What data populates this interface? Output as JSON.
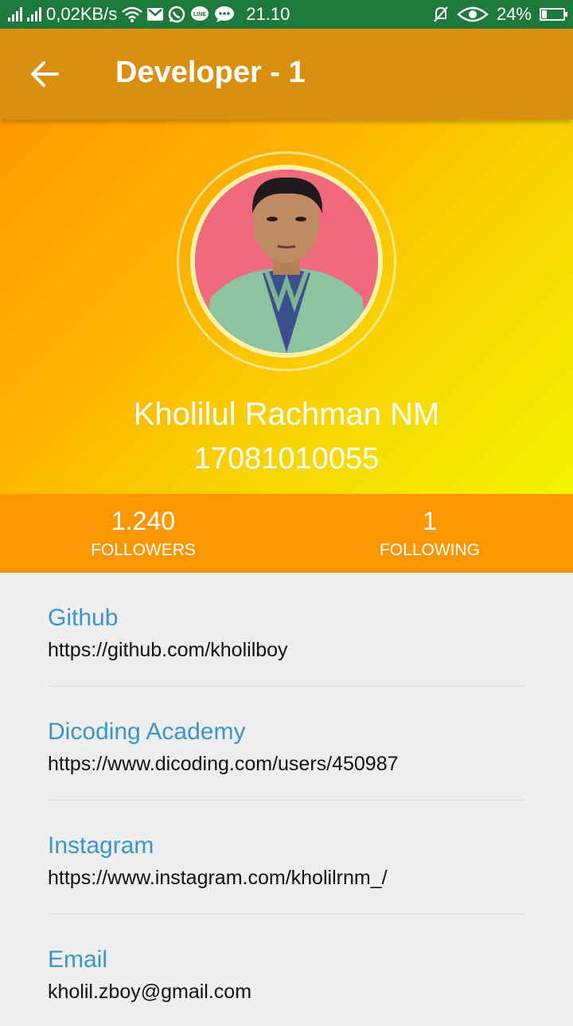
{
  "status_bar": {
    "network_speed": "0,02KB/s",
    "time": "21.10",
    "battery": "24%"
  },
  "app_bar": {
    "title": "Developer - 1"
  },
  "profile": {
    "name": "Kholilul Rachman NM",
    "nim": "17081010055"
  },
  "stats": {
    "followers_count": "1.240",
    "followers_label": "FOLLOWERS",
    "following_count": "1",
    "following_label": "FOLLOWING"
  },
  "links": [
    {
      "title": "Github",
      "url": "https://github.com/kholilboy"
    },
    {
      "title": "Dicoding Academy",
      "url": "https://www.dicoding.com/users/450987"
    },
    {
      "title": "Instagram",
      "url": "https://www.instagram.com/kholilrnm_/"
    },
    {
      "title": "Email",
      "url": "kholil.zboy@gmail.com"
    }
  ],
  "colors": {
    "status_bar": "#1e7a3c",
    "app_bar": "#d99012",
    "stats_bar": "#ff9800",
    "link_title": "#3c95c9"
  }
}
